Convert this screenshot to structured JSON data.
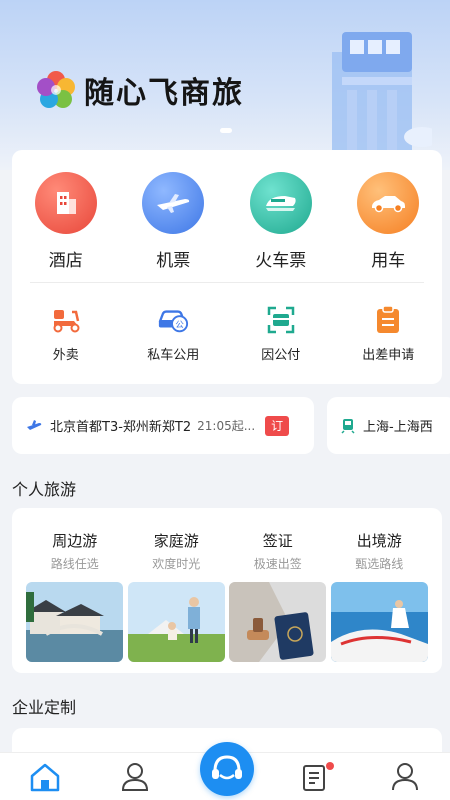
{
  "app": {
    "title": "随心飞商旅"
  },
  "colors": {
    "accent": "#1d8ef2",
    "badge_red": "#ef4b4b"
  },
  "services": {
    "primary": [
      {
        "label": "酒店",
        "icon": "hotel-icon"
      },
      {
        "label": "机票",
        "icon": "plane-icon"
      },
      {
        "label": "火车票",
        "icon": "train-icon"
      },
      {
        "label": "用车",
        "icon": "car-icon"
      }
    ],
    "secondary": [
      {
        "label": "外卖",
        "icon": "scooter-icon"
      },
      {
        "label": "私车公用",
        "icon": "private-car-icon"
      },
      {
        "label": "因公付",
        "icon": "scan-pay-icon"
      },
      {
        "label": "出差申请",
        "icon": "clipboard-icon"
      }
    ]
  },
  "trips": [
    {
      "route": "北京首都T3-郑州新郑T2",
      "time": "21:05起...",
      "badge": "订"
    },
    {
      "route": "上海-上海西"
    }
  ],
  "personal_travel": {
    "title": "个人旅游",
    "items": [
      {
        "name": "周边游",
        "sub": "路线任选"
      },
      {
        "name": "家庭游",
        "sub": "欢度时光"
      },
      {
        "name": "签证",
        "sub": "极速出签"
      },
      {
        "name": "出境游",
        "sub": "甄选路线"
      }
    ]
  },
  "enterprise": {
    "title": "企业定制"
  },
  "tabbar": {
    "tabs": [
      {
        "icon": "home-icon"
      },
      {
        "icon": "contacts-icon"
      },
      {
        "icon": "support-icon"
      },
      {
        "icon": "orders-icon"
      },
      {
        "icon": "profile-icon"
      }
    ]
  }
}
